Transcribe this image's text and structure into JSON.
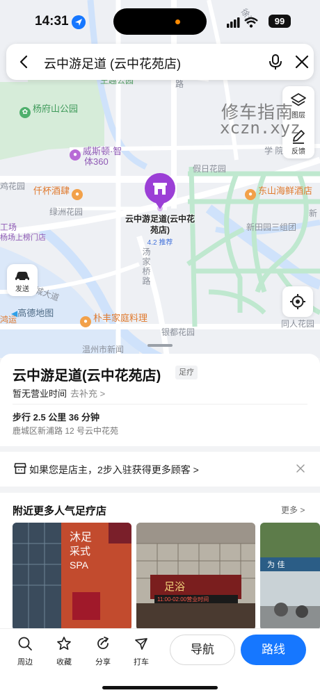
{
  "status_bar": {
    "time": "14:31",
    "battery": "99"
  },
  "search": {
    "query": "云中游足道 (云中花苑店)"
  },
  "map_tools": {
    "layers_label": "图层",
    "feedback_label": "反馈",
    "send_label": "发送"
  },
  "watermark": {
    "line1": "修车指南",
    "line2": "xczn.xyz"
  },
  "map_labels": {
    "yangfu_park": "杨府山公园",
    "wellington": "威斯顿·智",
    "wellington2": "体360",
    "jiari_garden": "假日花园",
    "xueyuan": "学 院",
    "qianhuan": "仟杯酒肆",
    "lvzhou": "绿洲花园",
    "dongshan": "东山海鲜酒店",
    "xintian": "新田园三组团",
    "gongchang": "工场",
    "shangbang": "杨场上榜门店",
    "tangjia": "汤家桥路",
    "puwen": "朴丰家庭料理",
    "yindu": "银都花园",
    "tongren": "同人花园",
    "wenzhou_news": "温州市新闻",
    "xincheng": "新城大道",
    "amap": "高德地图",
    "jiyi": "鸿运",
    "top_road1": "徐汇",
    "top_road2": "路",
    "top_park": "王越公园",
    "top_cut": "鸡花园",
    "xinhua": "新"
  },
  "pin": {
    "title": "云中游足道(云中花苑店)",
    "rating": "4.2 推荐"
  },
  "poi": {
    "name": "云中游足道(云中花苑店)",
    "tag": "足疗",
    "hours": "暂无营业时间",
    "hours_link": "去补充 >",
    "distance": "步行 2.5 公里  36 分钟",
    "address": "鹿城区新浦路 12 号云中花苑"
  },
  "owner_banner": {
    "text": "如果您是店主，2步入驻获得更多顾客 >"
  },
  "nearby": {
    "title": "附近更多人气足疗店",
    "more": "更多 >"
  },
  "thumbs": {
    "t1_sign1": "沐足",
    "t1_sign2": "采式",
    "t1_sign3": "SPA",
    "t2_sign": "足浴",
    "t2_led": "11:00-02:00营业时间",
    "t3_sign": "为 佳"
  },
  "tabs": [
    {
      "label": "周边"
    },
    {
      "label": "收藏"
    },
    {
      "label": "分享"
    },
    {
      "label": "打车"
    }
  ],
  "actions": {
    "navigate": "导航",
    "route": "路线"
  },
  "colors": {
    "accent": "#1677ff",
    "pin": "#9b3fd6",
    "map_bg": "#eef0f4",
    "park": "#d6ecd9",
    "water": "#cfe2fb",
    "road_green": "#bfe8cf"
  }
}
